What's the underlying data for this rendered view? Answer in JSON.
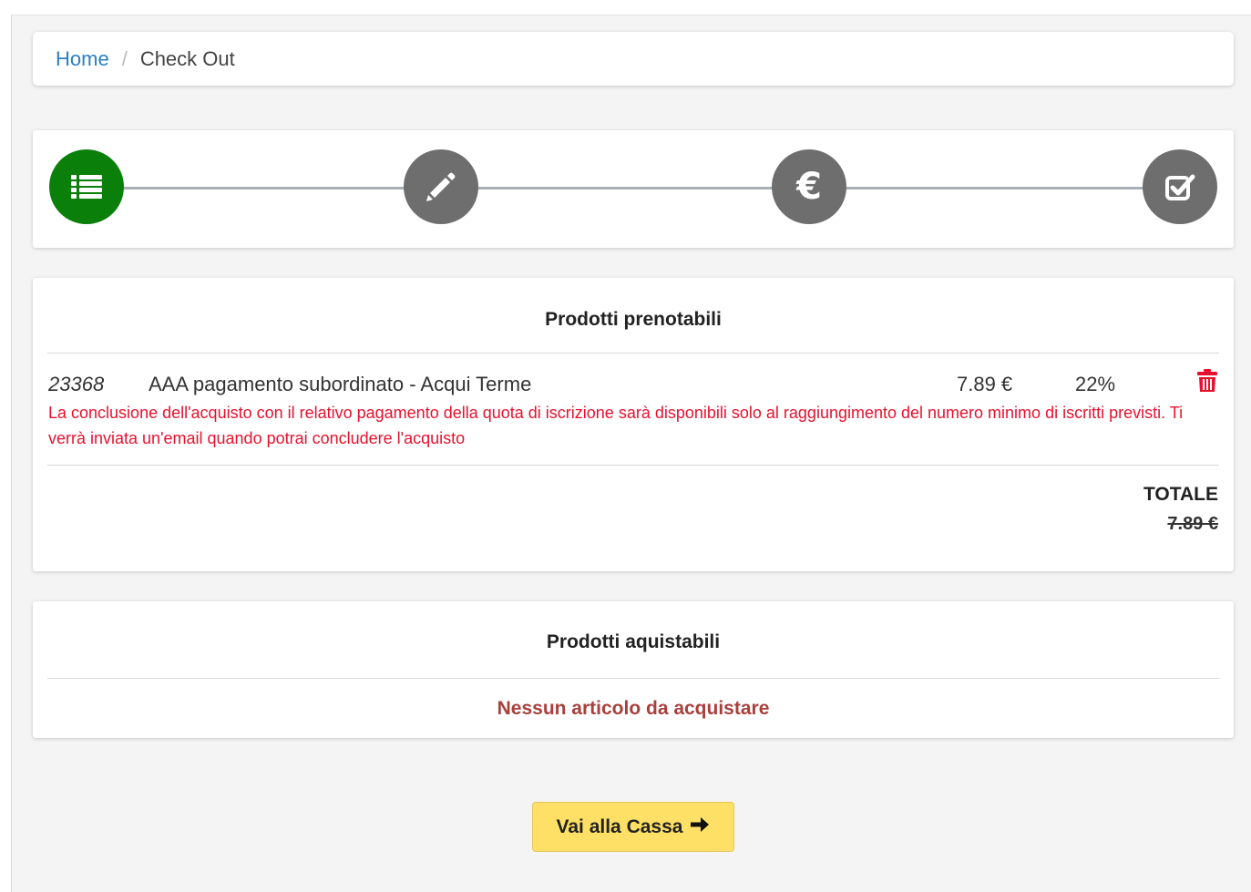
{
  "breadcrumb": {
    "home": "Home",
    "separator": "/",
    "current": "Check Out"
  },
  "stepper": {
    "steps": [
      {
        "icon": "list-icon",
        "state": "active"
      },
      {
        "icon": "pencil-icon",
        "state": "inactive"
      },
      {
        "icon": "euro-icon",
        "state": "inactive",
        "glyph": "€"
      },
      {
        "icon": "check-square-icon",
        "state": "inactive"
      }
    ],
    "active_color": "#0a7f0a",
    "inactive_color": "#6e6e6e"
  },
  "prenotabili": {
    "title": "Prodotti prenotabili",
    "items": [
      {
        "code": "23368",
        "name": "AAA pagamento subordinato - Acqui Terme",
        "price": "7.89 €",
        "vat": "22%"
      }
    ],
    "warning": "La conclusione dell'acquisto con il relativo pagamento della quota di iscrizione sarà disponibili solo al raggiungimento del numero minimo di iscritti previsti. Ti verrà inviata un'email quando potrai concludere l'acquisto",
    "total_label": "TOTALE",
    "total_value": "7.89 €"
  },
  "acquistabili": {
    "title": "Prodotti aquistabili",
    "empty_message": "Nessun articolo da acquistare"
  },
  "checkout_button": {
    "label": "Vai alla Cassa",
    "icon": "arrow-right-icon"
  },
  "colors": {
    "link": "#2a7fc6",
    "warning": "#e8112d",
    "empty_message": "#a8403c",
    "button_bg": "#ffe066",
    "trash": "#e8112d"
  }
}
